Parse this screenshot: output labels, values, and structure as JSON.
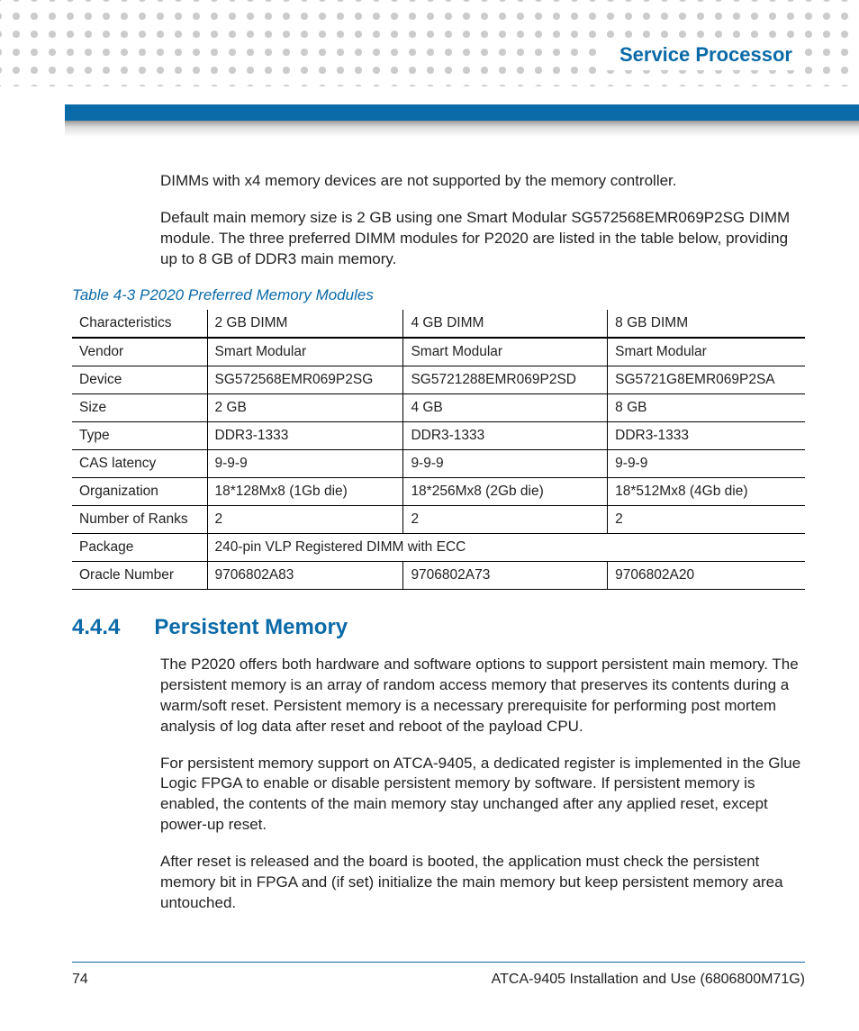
{
  "header": {
    "title": "Service Processor"
  },
  "intro": {
    "p1": "DIMMs with x4 memory devices are not supported by the memory controller.",
    "p2": "Default main memory size is 2 GB using one Smart Modular SG572568EMR069P2SG DIMM module. The three preferred DIMM modules for P2020 are listed in the table below, providing up to 8 GB of DDR3 main memory."
  },
  "table": {
    "caption": "Table 4-3 P2020 Preferred Memory Modules",
    "header": [
      "Characteristics",
      "2 GB DIMM",
      "4 GB DIMM",
      "8 GB DIMM"
    ],
    "rows": {
      "vendor": [
        "Vendor",
        "Smart Modular",
        "Smart Modular",
        "Smart Modular"
      ],
      "device": [
        "Device",
        "SG572568EMR069P2SG",
        "SG5721288EMR069P2SD",
        "SG5721G8EMR069P2SA"
      ],
      "size": [
        "Size",
        "2 GB",
        "4 GB",
        "8 GB"
      ],
      "type": [
        "Type",
        "DDR3-1333",
        "DDR3-1333",
        "DDR3-1333"
      ],
      "cas": [
        "CAS latency",
        "9-9-9",
        "9-9-9",
        "9-9-9"
      ],
      "org": [
        "Organization",
        "18*128Mx8 (1Gb die)",
        "18*256Mx8 (2Gb die)",
        "18*512Mx8 (4Gb die)"
      ],
      "ranks": [
        "Number of Ranks",
        "2",
        "2",
        "2"
      ],
      "package": [
        "Package",
        "240-pin VLP Registered DIMM with ECC"
      ],
      "oracle": [
        "Oracle Number",
        "9706802A83",
        "9706802A73",
        "9706802A20"
      ]
    }
  },
  "section": {
    "number": "4.4.4",
    "title": "Persistent Memory",
    "p1": "The P2020 offers both hardware and software options to support persistent main memory. The persistent memory is an array of random access memory that preserves its contents during a warm/soft reset. Persistent memory is a necessary prerequisite for performing post mortem analysis of log data after reset and reboot of the payload CPU.",
    "p2": "For persistent memory support on ATCA-9405, a dedicated register is implemented in the Glue Logic FPGA to enable or disable persistent memory by software. If persistent memory is enabled, the contents of the main memory stay unchanged after any applied reset, except power-up reset.",
    "p3": "After reset is released and the board is booted, the application must check the persistent memory bit in FPGA and (if set) initialize the main memory but keep persistent memory area untouched."
  },
  "footer": {
    "page": "74",
    "doc": "ATCA-9405 Installation and Use (6806800M71G)"
  }
}
